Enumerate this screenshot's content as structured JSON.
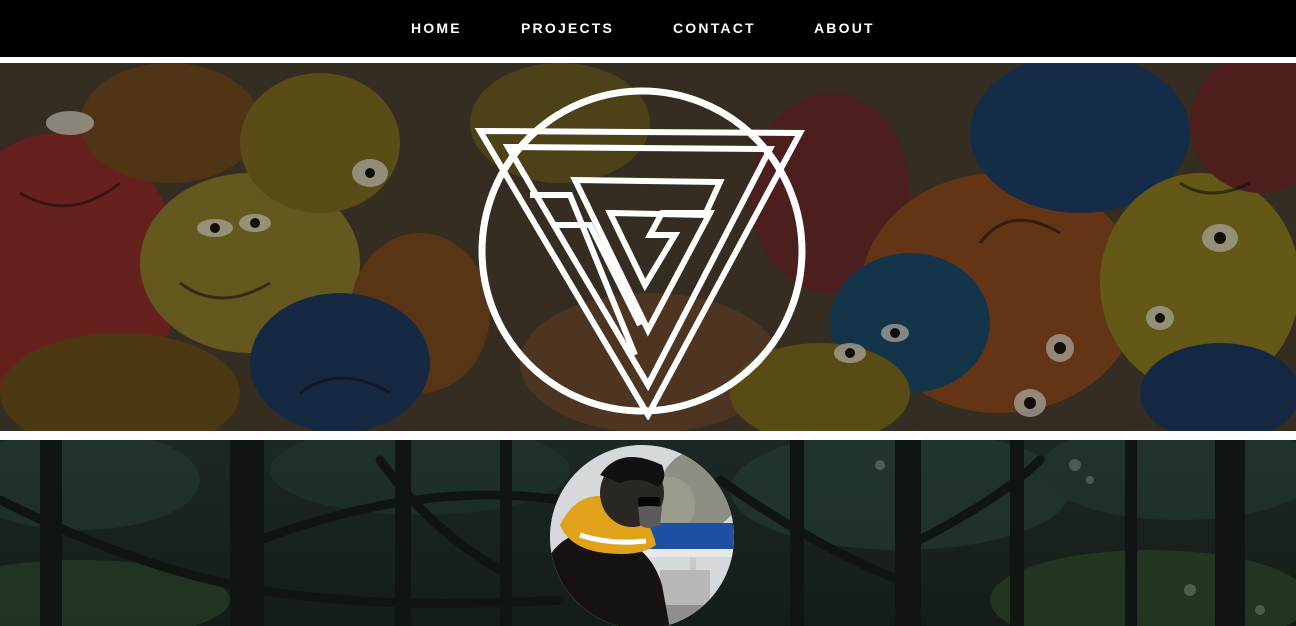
{
  "nav": {
    "items": [
      {
        "label": "HOME"
      },
      {
        "label": "PROJECTS"
      },
      {
        "label": "CONTACT"
      },
      {
        "label": "ABOUT"
      }
    ]
  },
  "hero": {
    "logo_icon": "vg-monogram-circle-logo",
    "background": "graffiti-faces-mural"
  },
  "profile": {
    "avatar": "profile-photo-person-in-yellow-hoodie",
    "background": "dark-forest-illustration"
  },
  "colors": {
    "nav_background": "#000000",
    "nav_text": "#ffffff",
    "divider": "#ffffff"
  }
}
